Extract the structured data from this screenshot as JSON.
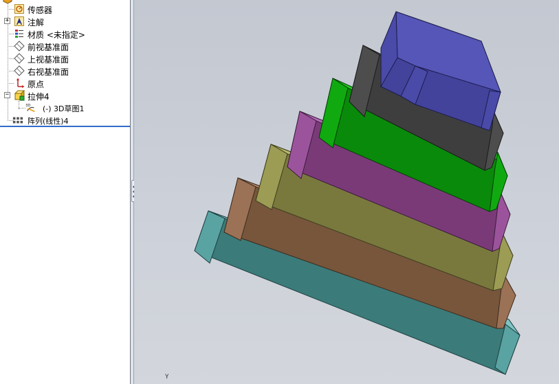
{
  "tree": {
    "items": [
      {
        "label": "传感器",
        "icon": "sensor-icon"
      },
      {
        "label": "注解",
        "icon": "annotation-icon",
        "expander": "+"
      },
      {
        "label": "材质 <未指定>",
        "icon": "material-icon"
      },
      {
        "label": "前视基准面",
        "icon": "plane-icon"
      },
      {
        "label": "上视基准面",
        "icon": "plane-icon"
      },
      {
        "label": "右视基准面",
        "icon": "plane-icon"
      },
      {
        "label": "原点",
        "icon": "origin-icon"
      },
      {
        "label": "拉伸4",
        "icon": "extrude-icon",
        "expander": "−"
      },
      {
        "label": "(-) 3D草图1",
        "icon": "sketch3d-icon"
      },
      {
        "label": "阵列(线性)4",
        "icon": "linear-pattern-icon"
      }
    ]
  },
  "viewport": {
    "axis_label": "Y",
    "slabs": [
      {
        "name": "teal",
        "top": "#7fc4c4",
        "front": "#3b7b7a",
        "side": "#5aa3a3"
      },
      {
        "name": "brown",
        "top": "#b3876a",
        "front": "#77563c",
        "side": "#9b7256"
      },
      {
        "name": "olive",
        "top": "#b8b869",
        "front": "#79793e",
        "side": "#9c9c55"
      },
      {
        "name": "purple",
        "top": "#b46ab8",
        "front": "#7a3a78",
        "side": "#9b549c"
      },
      {
        "name": "green",
        "top": "#22cc22",
        "front": "#0a8a0a",
        "side": "#10aa10"
      },
      {
        "name": "gray",
        "top": "#5c5c5c",
        "front": "#3e3e3e",
        "side": "#4d4d4d"
      },
      {
        "name": "blue",
        "top": "#5656b8",
        "front": "#43439c",
        "side": "#4a4aa8"
      }
    ]
  }
}
